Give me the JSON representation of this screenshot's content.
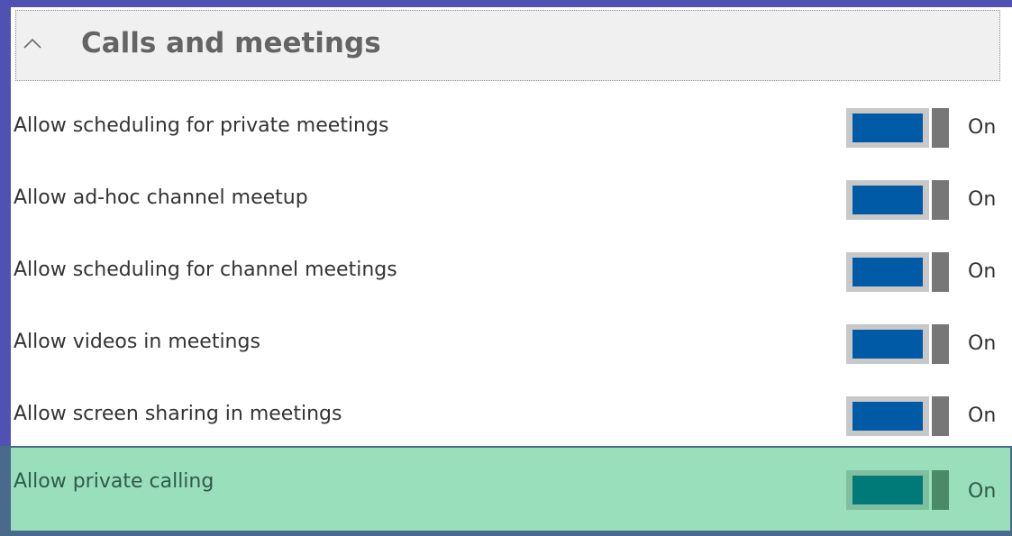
{
  "section": {
    "title": "Calls and meetings",
    "icon": "chevron-up-icon",
    "expanded": true
  },
  "settings": [
    {
      "label": "Allow scheduling for private meetings",
      "state": "On",
      "enabled": true
    },
    {
      "label": "Allow ad-hoc channel meetup",
      "state": "On",
      "enabled": true
    },
    {
      "label": "Allow scheduling for channel meetings",
      "state": "On",
      "enabled": true
    },
    {
      "label": "Allow videos in meetings",
      "state": "On",
      "enabled": true
    },
    {
      "label": "Allow screen sharing in meetings",
      "state": "On",
      "enabled": true
    },
    {
      "label": "Allow private calling",
      "state": "On",
      "enabled": true,
      "highlighted": true
    }
  ],
  "colors": {
    "frame": "#4f52b2",
    "toggle_on": "#005aa5",
    "highlight_bg": "#9adfbb",
    "highlight_toggle": "#007a78"
  }
}
